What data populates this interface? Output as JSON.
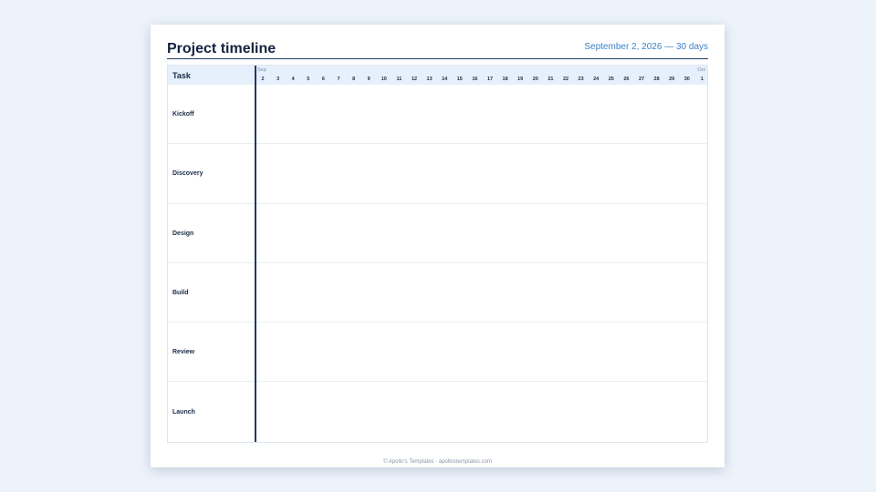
{
  "document": {
    "title": "Project timeline",
    "subtitle": "September 2, 2026 — 30 days"
  },
  "table": {
    "task_header": "Task",
    "months": [
      {
        "label": "Sep",
        "at_day_index": 0
      },
      {
        "label": "Oct",
        "at_day_index": 29
      }
    ],
    "days": [
      "2",
      "3",
      "4",
      "5",
      "6",
      "7",
      "8",
      "9",
      "10",
      "11",
      "12",
      "13",
      "14",
      "15",
      "16",
      "17",
      "18",
      "19",
      "20",
      "21",
      "22",
      "23",
      "24",
      "25",
      "26",
      "27",
      "28",
      "29",
      "30",
      "1"
    ],
    "tasks": [
      "Kickoff",
      "Discovery",
      "Design",
      "Build",
      "Review",
      "Launch"
    ]
  },
  "footer": {
    "text": "© Apollo's Templates · apollostemplates.com"
  },
  "colors": {
    "page_background": "#edf3fb",
    "header_fill": "#e6f0fd",
    "accent": "#3b82c9",
    "ink": "#13233f"
  }
}
